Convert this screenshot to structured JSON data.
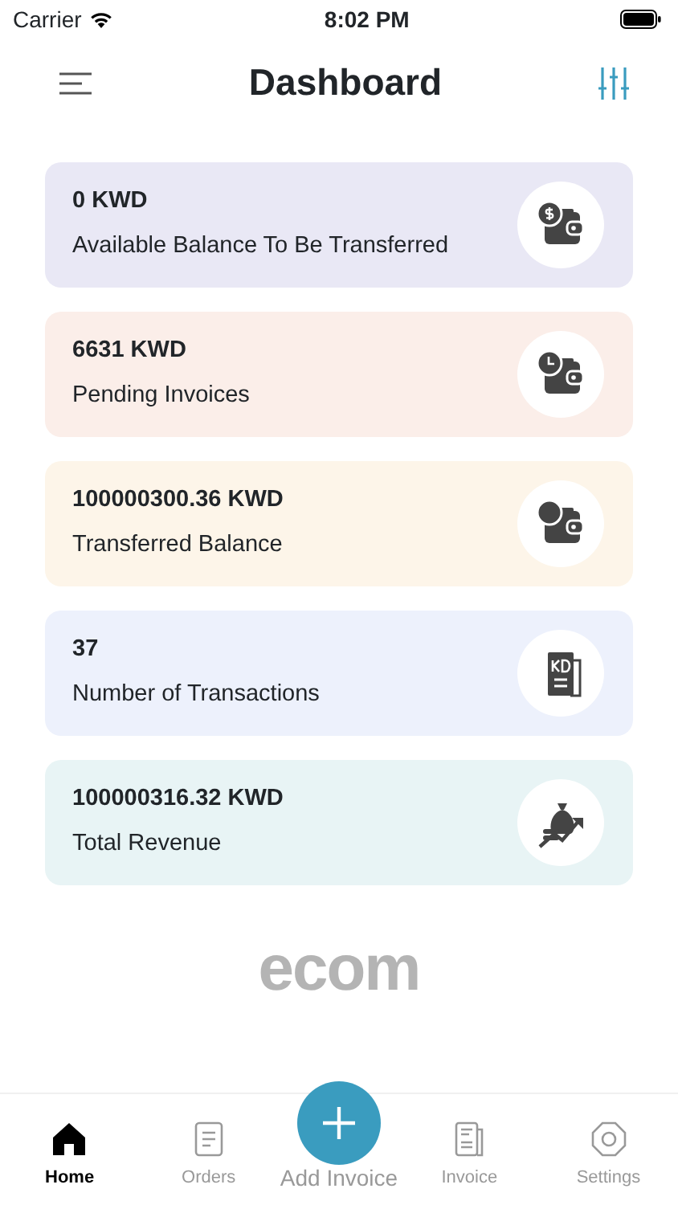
{
  "status_bar": {
    "carrier": "Carrier",
    "time": "8:02 PM"
  },
  "header": {
    "title": "Dashboard"
  },
  "cards": [
    {
      "value": "0 KWD",
      "label": "Available Balance To Be Transferred",
      "color": "#e9e8f5"
    },
    {
      "value": "6631 KWD",
      "label": "Pending Invoices",
      "color": "#fbeee9"
    },
    {
      "value": "100000300.36 KWD",
      "label": "Transferred Balance",
      "color": "#fdf5e9"
    },
    {
      "value": "37",
      "label": "Number of Transactions",
      "color": "#edf1fc"
    },
    {
      "value": "100000316.32 KWD",
      "label": "Total Revenue",
      "color": "#e8f4f5"
    }
  ],
  "logo": "ecom",
  "tab_bar": [
    {
      "label": "Home",
      "kind": "tab",
      "selected": true
    },
    {
      "label": "Orders",
      "kind": "tab",
      "selected": false
    },
    {
      "label": "Add Invoice",
      "kind": "fab"
    },
    {
      "label": "Invoice",
      "kind": "tab",
      "selected": false
    },
    {
      "label": "Settings",
      "kind": "tab",
      "selected": false
    }
  ]
}
